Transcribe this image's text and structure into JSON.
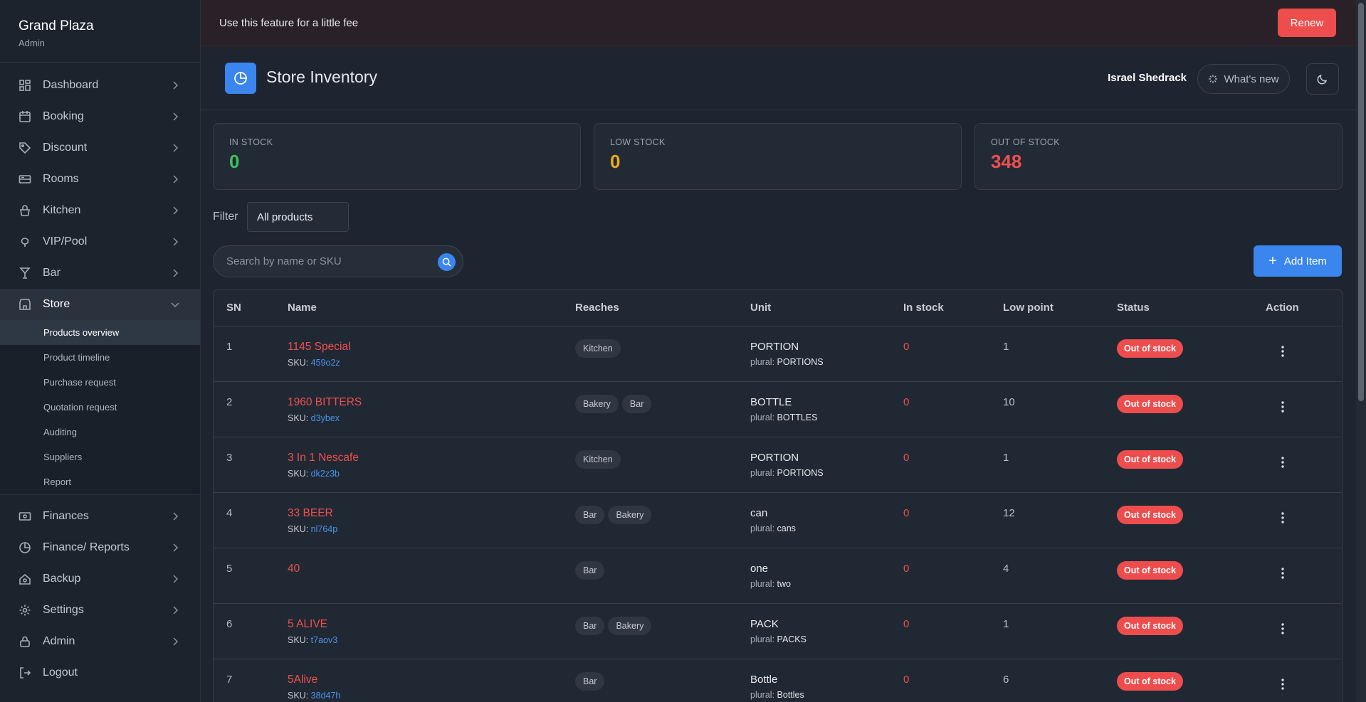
{
  "brand": {
    "name": "Grand Plaza",
    "role": "Admin"
  },
  "nav": {
    "items": [
      {
        "label": "Dashboard",
        "icon": "dashboard-icon"
      },
      {
        "label": "Booking",
        "icon": "calendar-icon"
      },
      {
        "label": "Discount",
        "icon": "tag-icon"
      },
      {
        "label": "Rooms",
        "icon": "bed-icon"
      },
      {
        "label": "Kitchen",
        "icon": "basket-icon"
      },
      {
        "label": "VIP/Pool",
        "icon": "balloon-icon"
      },
      {
        "label": "Bar",
        "icon": "cocktail-icon"
      },
      {
        "label": "Store",
        "icon": "store-icon"
      }
    ],
    "store_sub": [
      "Products overview",
      "Product timeline",
      "Purchase request",
      "Quotation request",
      "Auditing",
      "Suppliers",
      "Report"
    ],
    "after": [
      {
        "label": "Finances",
        "icon": "cash-icon"
      },
      {
        "label": "Finance/ Reports",
        "icon": "pie-chart-icon"
      },
      {
        "label": "Backup",
        "icon": "backup-icon"
      },
      {
        "label": "Settings",
        "icon": "gear-icon"
      },
      {
        "label": "Admin",
        "icon": "lock-icon"
      },
      {
        "label": "Logout",
        "icon": "logout-icon"
      }
    ]
  },
  "banner": {
    "text": "Use this feature for a little fee",
    "button": "Renew"
  },
  "header": {
    "title": "Store Inventory",
    "user": "Israel Shedrack",
    "whats_new": "What's new"
  },
  "stats": [
    {
      "label": "IN STOCK",
      "value": "0",
      "color": "#3fbf5f"
    },
    {
      "label": "LOW STOCK",
      "value": "0",
      "color": "#f0a81e"
    },
    {
      "label": "OUT OF STOCK",
      "value": "348",
      "color": "#ef4f4f"
    }
  ],
  "filter": {
    "label": "Filter",
    "value": "All products"
  },
  "search": {
    "placeholder": "Search by name or SKU"
  },
  "add_button": "Add Item",
  "table": {
    "columns": [
      "SN",
      "Name",
      "Reaches",
      "Unit",
      "In stock",
      "Low point",
      "Status",
      "Action"
    ],
    "rows": [
      {
        "sn": "1",
        "name": "1145 Special",
        "sku": "459o2z",
        "reaches": [
          "Kitchen"
        ],
        "unit": "PORTION",
        "plural": "PORTIONS",
        "in_stock": "0",
        "low_point": "1",
        "status": "Out of stock"
      },
      {
        "sn": "2",
        "name": "1960 BITTERS",
        "sku": "d3ybex",
        "reaches": [
          "Bakery",
          "Bar"
        ],
        "unit": "BOTTLE",
        "plural": "BOTTLES",
        "in_stock": "0",
        "low_point": "10",
        "status": "Out of stock"
      },
      {
        "sn": "3",
        "name": "3 In 1 Nescafe",
        "sku": "dk2z3b",
        "reaches": [
          "Kitchen"
        ],
        "unit": "PORTION",
        "plural": "PORTIONS",
        "in_stock": "0",
        "low_point": "1",
        "status": "Out of stock"
      },
      {
        "sn": "4",
        "name": "33 BEER",
        "sku": "nl764p",
        "reaches": [
          "Bar",
          "Bakery"
        ],
        "unit": "can",
        "plural": "cans",
        "in_stock": "0",
        "low_point": "12",
        "status": "Out of stock"
      },
      {
        "sn": "5",
        "name": "40",
        "sku": "",
        "reaches": [
          "Bar"
        ],
        "unit": "one",
        "plural": "two",
        "in_stock": "0",
        "low_point": "4",
        "status": "Out of stock"
      },
      {
        "sn": "6",
        "name": "5 ALIVE",
        "sku": "t7aov3",
        "reaches": [
          "Bar",
          "Bakery"
        ],
        "unit": "PACK",
        "plural": "PACKS",
        "in_stock": "0",
        "low_point": "1",
        "status": "Out of stock"
      },
      {
        "sn": "7",
        "name": "5Alive",
        "sku": "38d47h",
        "reaches": [
          "Bar"
        ],
        "unit": "Bottle",
        "plural": "Bottles",
        "in_stock": "0",
        "low_point": "6",
        "status": "Out of stock"
      }
    ],
    "sku_prefix": "SKU:",
    "plural_prefix": "plural:"
  }
}
